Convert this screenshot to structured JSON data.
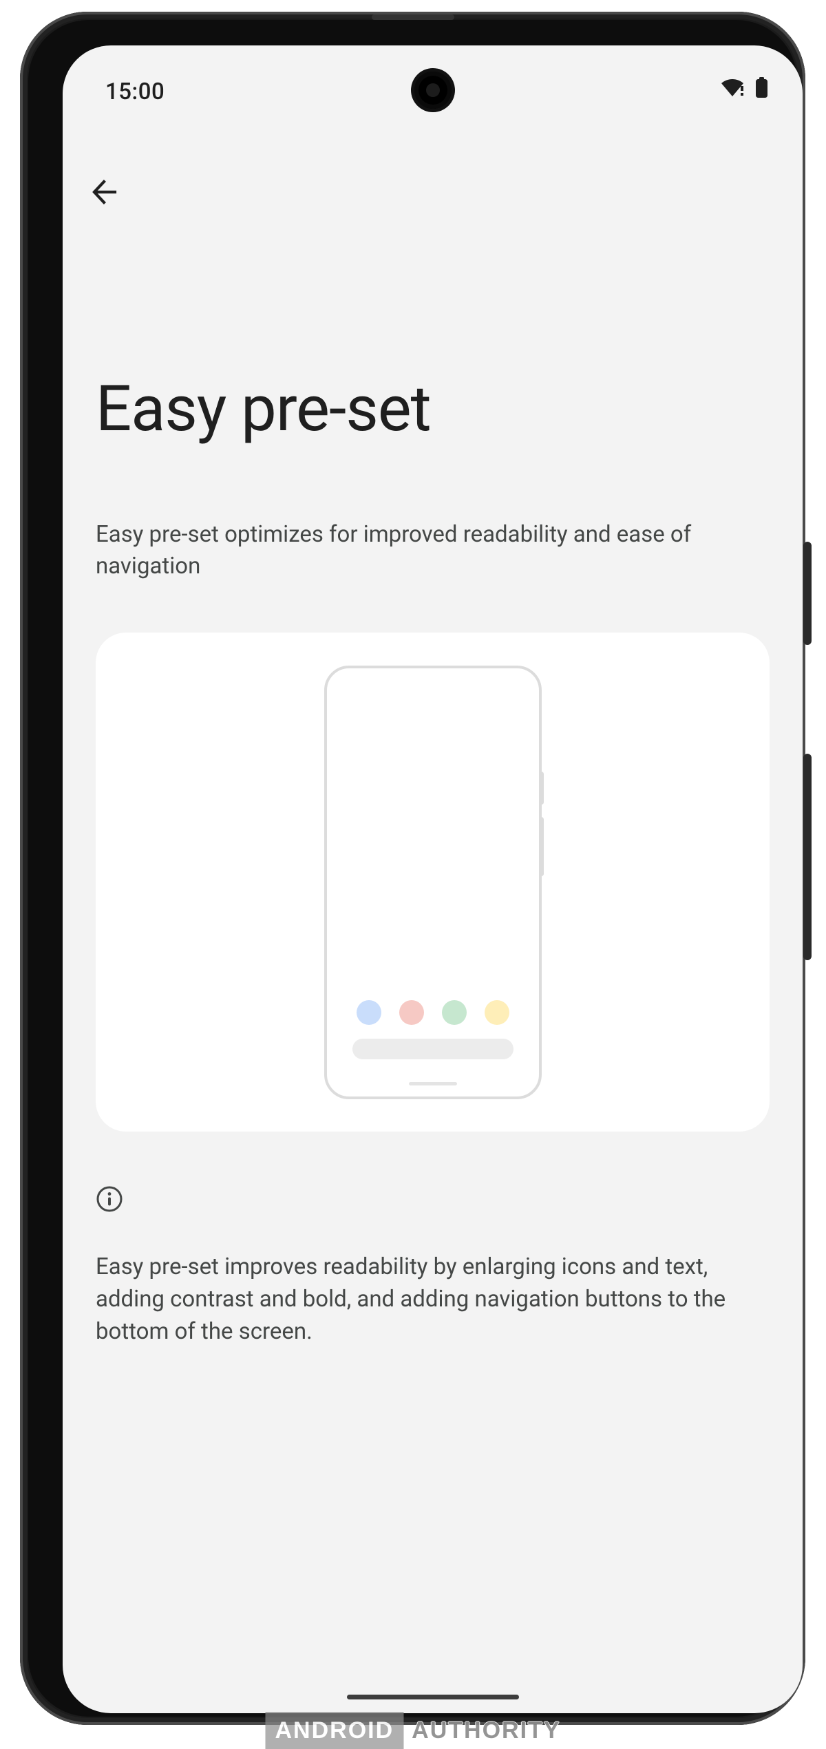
{
  "statusbar": {
    "time": "15:00"
  },
  "page": {
    "title": "Easy pre-set",
    "subtitle": "Easy pre-set optimizes for improved readability and ease of navigation",
    "detail": "Easy pre-set improves readability by enlarging icons and text, adding contrast and bold, and adding navigation buttons to the bottom of the screen."
  },
  "watermark": {
    "left": "ANDROID",
    "right": "AUTHORITY"
  }
}
